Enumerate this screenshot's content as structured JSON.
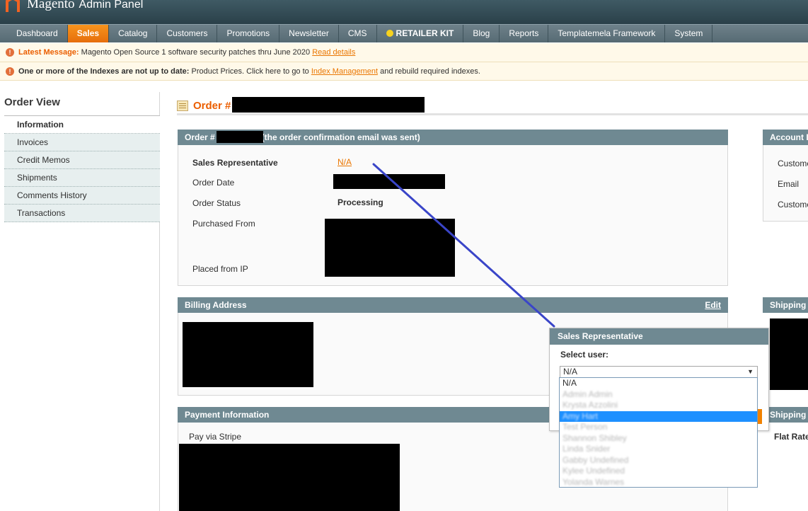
{
  "header": {
    "logo_text": "Magento",
    "logo_sub": "Admin Panel"
  },
  "nav": {
    "items": [
      {
        "label": "Dashboard"
      },
      {
        "label": "Sales"
      },
      {
        "label": "Catalog"
      },
      {
        "label": "Customers"
      },
      {
        "label": "Promotions"
      },
      {
        "label": "Newsletter"
      },
      {
        "label": "CMS"
      },
      {
        "label": "RETAILER KIT"
      },
      {
        "label": "Blog"
      },
      {
        "label": "Reports"
      },
      {
        "label": "Templatemela Framework"
      },
      {
        "label": "System"
      }
    ],
    "active": "Sales"
  },
  "notices": {
    "latest": {
      "label": "Latest Message:",
      "text": "Magento Open Source 1 software security patches thru June 2020",
      "link": "Read details"
    },
    "indexes": {
      "bold": "One or more of the Indexes are not up to date:",
      "text_before": "Product Prices. Click here to go to",
      "link": "Index Management",
      "text_after": "and rebuild required indexes."
    }
  },
  "sidebar": {
    "title": "Order View",
    "tabs": [
      {
        "label": "Information"
      },
      {
        "label": "Invoices"
      },
      {
        "label": "Credit Memos"
      },
      {
        "label": "Shipments"
      },
      {
        "label": "Comments History"
      },
      {
        "label": "Transactions"
      }
    ]
  },
  "page": {
    "title": "Order #"
  },
  "order_box": {
    "head_prefix": "Order #",
    "head_suffix": "(the order confirmation email was sent)",
    "sales_rep_label": "Sales Representative",
    "sales_rep_value": "N/A",
    "order_date_label": "Order Date",
    "order_status_label": "Order Status",
    "order_status_value": "Processing",
    "purchased_from_label": "Purchased From",
    "placed_ip_label": "Placed from IP"
  },
  "account_box": {
    "head": "Account I",
    "rows": [
      "Custome",
      "Email",
      "Custome"
    ]
  },
  "billing_box": {
    "head": "Billing Address",
    "edit": "Edit"
  },
  "shipping_box": {
    "head": "Shipping"
  },
  "payment_box": {
    "head": "Payment Information",
    "method": "Pay via Stripe"
  },
  "shipping_method_box": {
    "head": "Shipping",
    "value": "Flat Rate"
  },
  "popup": {
    "title": "Sales Representative",
    "select_label": "Select user:",
    "selected": "N/A",
    "options": [
      {
        "label": "N/A",
        "state": "normal"
      },
      {
        "label": "Admin Admin",
        "state": "blur"
      },
      {
        "label": "Krysta Azzolini",
        "state": "blur"
      },
      {
        "label": "Amy Hart",
        "state": "selected"
      },
      {
        "label": "Test Person",
        "state": "blur"
      },
      {
        "label": "Shannon Shibley",
        "state": "blur"
      },
      {
        "label": "Linda Snider",
        "state": "blur"
      },
      {
        "label": "Gabby Undefined",
        "state": "blur"
      },
      {
        "label": "Kylee Undefined",
        "state": "blur"
      },
      {
        "label": "Yolanda Warnes",
        "state": "blur"
      }
    ]
  },
  "colors": {
    "accent_orange": "#eb5e00",
    "box_header": "#6f8992",
    "annotation_line": "#3a45c8",
    "selected_option": "#1e90ff"
  }
}
